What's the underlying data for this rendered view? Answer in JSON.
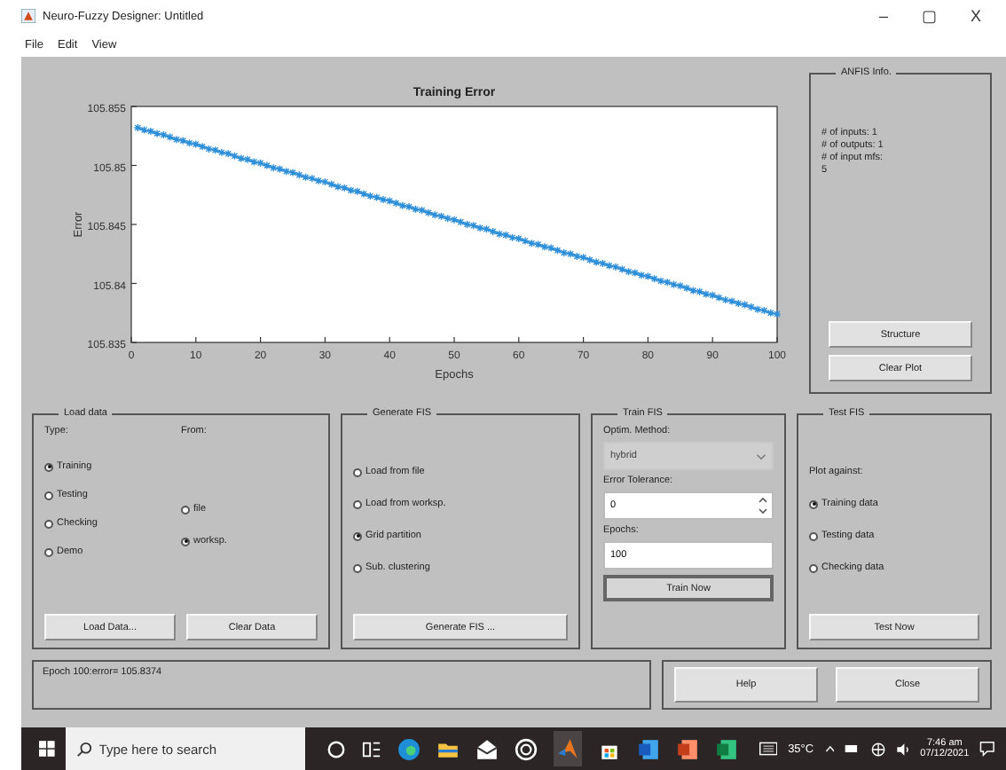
{
  "window": {
    "title": "Neuro-Fuzzy Designer: Untitled",
    "controls": [
      "–",
      "▢",
      "X"
    ]
  },
  "menu": [
    "File",
    "Edit",
    "View"
  ],
  "plot": {
    "chart_data": {
      "type": "line",
      "title": "Training Error",
      "xlabel": "Epochs",
      "ylabel": "Error",
      "xlim": [
        0,
        100
      ],
      "ylim": [
        105.835,
        105.855
      ],
      "xticks": [
        0,
        10,
        20,
        30,
        40,
        50,
        60,
        70,
        80,
        90,
        100
      ],
      "yticks": [
        105.835,
        105.84,
        105.845,
        105.85,
        105.855
      ],
      "x": [
        1,
        2,
        3,
        4,
        5,
        6,
        7,
        8,
        9,
        10,
        11,
        12,
        13,
        14,
        15,
        16,
        17,
        18,
        19,
        20,
        21,
        22,
        23,
        24,
        25,
        26,
        27,
        28,
        29,
        30,
        31,
        32,
        33,
        34,
        35,
        36,
        37,
        38,
        39,
        40,
        41,
        42,
        43,
        44,
        45,
        46,
        47,
        48,
        49,
        50,
        51,
        52,
        53,
        54,
        55,
        56,
        57,
        58,
        59,
        60,
        61,
        62,
        63,
        64,
        65,
        66,
        67,
        68,
        69,
        70,
        71,
        72,
        73,
        74,
        75,
        76,
        77,
        78,
        79,
        80,
        81,
        82,
        83,
        84,
        85,
        86,
        87,
        88,
        89,
        90,
        91,
        92,
        93,
        94,
        95,
        96,
        97,
        98,
        99,
        100
      ],
      "series": [
        {
          "color": "#2e8fd8",
          "values": [
            105.8532,
            105.853,
            105.8529,
            105.8527,
            105.8526,
            105.8524,
            105.8522,
            105.8521,
            105.8519,
            105.8518,
            105.8516,
            105.8514,
            105.8513,
            105.8511,
            105.851,
            105.8508,
            105.8506,
            105.8505,
            105.8503,
            105.8502,
            105.85,
            105.8498,
            105.8497,
            105.8495,
            105.8494,
            105.8492,
            105.849,
            105.8489,
            105.8487,
            105.8486,
            105.8484,
            105.8482,
            105.8481,
            105.8479,
            105.8478,
            105.8476,
            105.8474,
            105.8473,
            105.8471,
            105.847,
            105.8468,
            105.8466,
            105.8465,
            105.8463,
            105.8462,
            105.846,
            105.8458,
            105.8457,
            105.8455,
            105.8454,
            105.8452,
            105.845,
            105.8449,
            105.8447,
            105.8446,
            105.8444,
            105.8442,
            105.8441,
            105.8439,
            105.8438,
            105.8436,
            105.8434,
            105.8433,
            105.8431,
            105.843,
            105.8428,
            105.8426,
            105.8425,
            105.8423,
            105.8422,
            105.842,
            105.8418,
            105.8417,
            105.8415,
            105.8414,
            105.8412,
            105.841,
            105.8409,
            105.8407,
            105.8406,
            105.8404,
            105.8402,
            105.8401,
            105.8399,
            105.8398,
            105.8396,
            105.8394,
            105.8393,
            105.8391,
            105.839,
            105.8388,
            105.8386,
            105.8385,
            105.8383,
            105.8382,
            105.838,
            105.8378,
            105.8377,
            105.8375,
            105.8374
          ]
        }
      ]
    }
  },
  "anfis_info": {
    "title": "ANFIS Info.",
    "lines": [
      "# of inputs: 1",
      "# of outputs: 1",
      "# of input mfs:",
      "5"
    ],
    "buttons": [
      "Structure",
      "Clear Plot"
    ]
  },
  "load_data": {
    "title": "Load data",
    "type_label": "Type:",
    "from_label": "From:",
    "types": [
      {
        "label": "Training",
        "selected": true
      },
      {
        "label": "Testing",
        "selected": false
      },
      {
        "label": "Checking",
        "selected": false
      },
      {
        "label": "Demo",
        "selected": false
      }
    ],
    "sources": [
      {
        "label": "file",
        "selected": false
      },
      {
        "label": "worksp.",
        "selected": true
      }
    ],
    "buttons": [
      "Load Data...",
      "Clear Data"
    ]
  },
  "generate_fis": {
    "title": "Generate FIS",
    "options": [
      {
        "label": "Load from file",
        "selected": false
      },
      {
        "label": "Load from worksp.",
        "selected": false
      },
      {
        "label": "Grid partition",
        "selected": true
      },
      {
        "label": "Sub. clustering",
        "selected": false
      }
    ],
    "button": "Generate FIS ..."
  },
  "train_fis": {
    "title": "Train FIS",
    "method_label": "Optim. Method:",
    "method": "hybrid",
    "tolerance_label": "Error Tolerance:",
    "tolerance": "0",
    "epochs_label": "Epochs:",
    "epochs": "100",
    "button": "Train Now"
  },
  "test_fis": {
    "title": "Test FIS",
    "plot_label": "Plot against:",
    "options": [
      {
        "label": "Training data",
        "selected": true
      },
      {
        "label": "Testing data",
        "selected": false
      },
      {
        "label": "Checking data",
        "selected": false
      }
    ],
    "button": "Test Now"
  },
  "status": "Epoch 100:error= 105.8374",
  "bottom_buttons": [
    "Help",
    "Close"
  ],
  "taskbar": {
    "search_placeholder": "Type here to search",
    "weather": "35°C",
    "time": "7:46 am",
    "date": "07/12/2021"
  }
}
